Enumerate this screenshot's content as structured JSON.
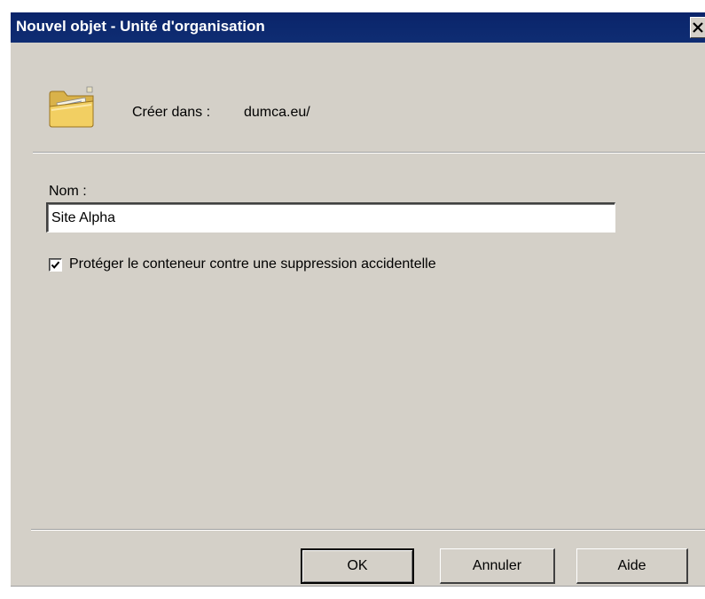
{
  "window": {
    "title": "Nouvel objet - Unité d'organisation"
  },
  "header": {
    "icon": "folder-ou-icon",
    "create_in_label": "Créer dans :",
    "create_in_value": "dumca.eu/"
  },
  "form": {
    "name_label": "Nom :",
    "name_value": "Site Alpha",
    "protect_label": "Protéger le conteneur contre une suppression accidentelle",
    "protect_checked": true
  },
  "buttons": {
    "ok": "OK",
    "cancel": "Annuler",
    "help": "Aide"
  },
  "colors": {
    "titlebar": "#0a246a",
    "dialog_bg": "#d4d0c8"
  }
}
